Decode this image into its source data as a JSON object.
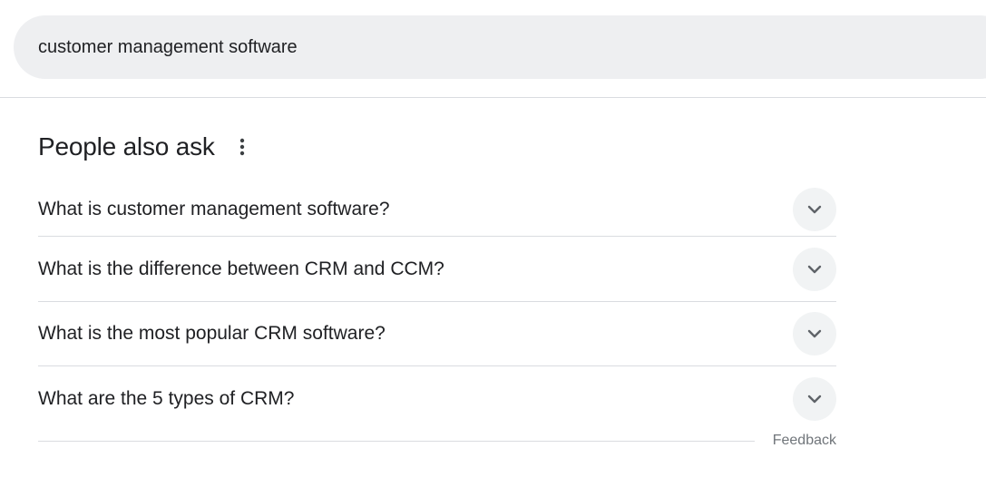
{
  "search": {
    "query": "customer management software"
  },
  "paa": {
    "title": "People also ask",
    "more_icon": "more-vert-icon",
    "expand_icon": "chevron-down-icon",
    "questions": [
      "What is customer management software?",
      "What is the difference between CRM and CCM?",
      "What is the most popular CRM software?",
      "What are the 5 types of CRM?"
    ]
  },
  "footer": {
    "feedback_label": "Feedback"
  },
  "colors": {
    "search_bg": "#eeeff1",
    "divider": "#dadce0",
    "expand_bg": "#f1f3f4",
    "text": "#202124",
    "muted": "#70757a"
  }
}
